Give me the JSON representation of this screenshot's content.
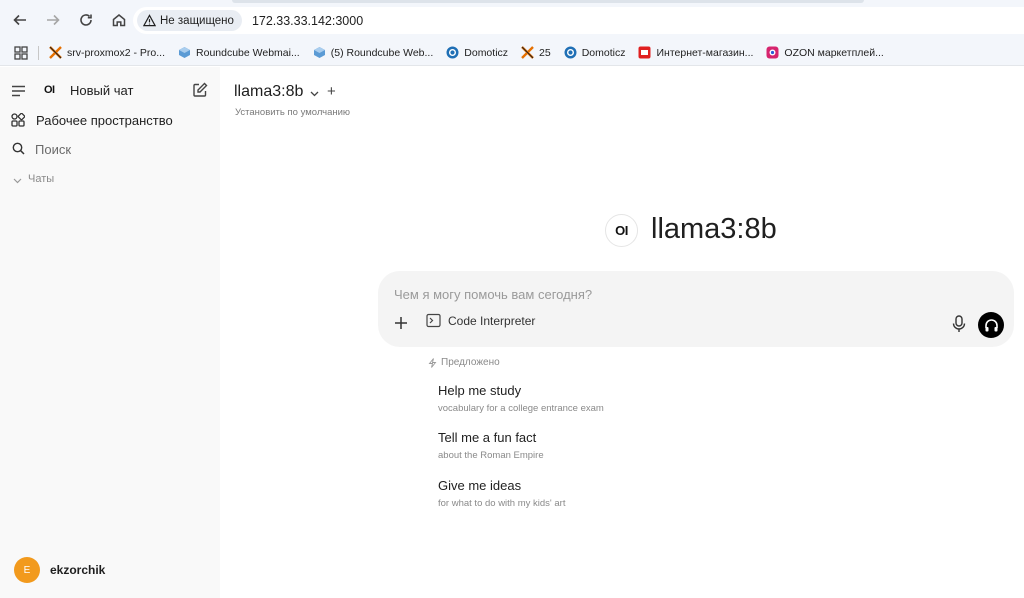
{
  "browser": {
    "security_label": "Не защищено",
    "url": "172.33.33.142:3000"
  },
  "bookmarks": [
    {
      "label": "srv-proxmox2 - Pro...",
      "icon": "proxmox-icon"
    },
    {
      "label": "Roundcube Webmai...",
      "icon": "roundcube-icon"
    },
    {
      "label": "(5) Roundcube Web...",
      "icon": "roundcube-icon"
    },
    {
      "label": "Domoticz",
      "icon": "domoticz-icon"
    },
    {
      "label": "25",
      "icon": "proxmox-icon"
    },
    {
      "label": "Domoticz",
      "icon": "domoticz-icon"
    },
    {
      "label": "Интернет-магазин...",
      "icon": "shop-icon"
    },
    {
      "label": "OZON маркетплей...",
      "icon": "ozon-icon"
    }
  ],
  "sidebar": {
    "logo_text": "OI",
    "new_chat": "Новый чат",
    "workspace": "Рабочее пространство",
    "search": "Поиск",
    "chats_section": "Чаты",
    "user": {
      "initial": "E",
      "name": "ekzorchik",
      "avatar_color": "#f29a1d"
    }
  },
  "main": {
    "model_name": "llama3:8b",
    "set_default": "Установить по умолчанию",
    "hero_logo": "OI",
    "hero_title": "llama3:8b",
    "input_placeholder": "Чем я могу помочь вам сегодня?",
    "code_interpreter": "Code Interpreter",
    "suggested_label": "Предложено",
    "suggestions": [
      {
        "title": "Help me study",
        "subtitle": "vocabulary for a college entrance exam"
      },
      {
        "title": "Tell me a fun fact",
        "subtitle": "about the Roman Empire"
      },
      {
        "title": "Give me ideas",
        "subtitle": "for what to do with my kids' art"
      }
    ]
  }
}
